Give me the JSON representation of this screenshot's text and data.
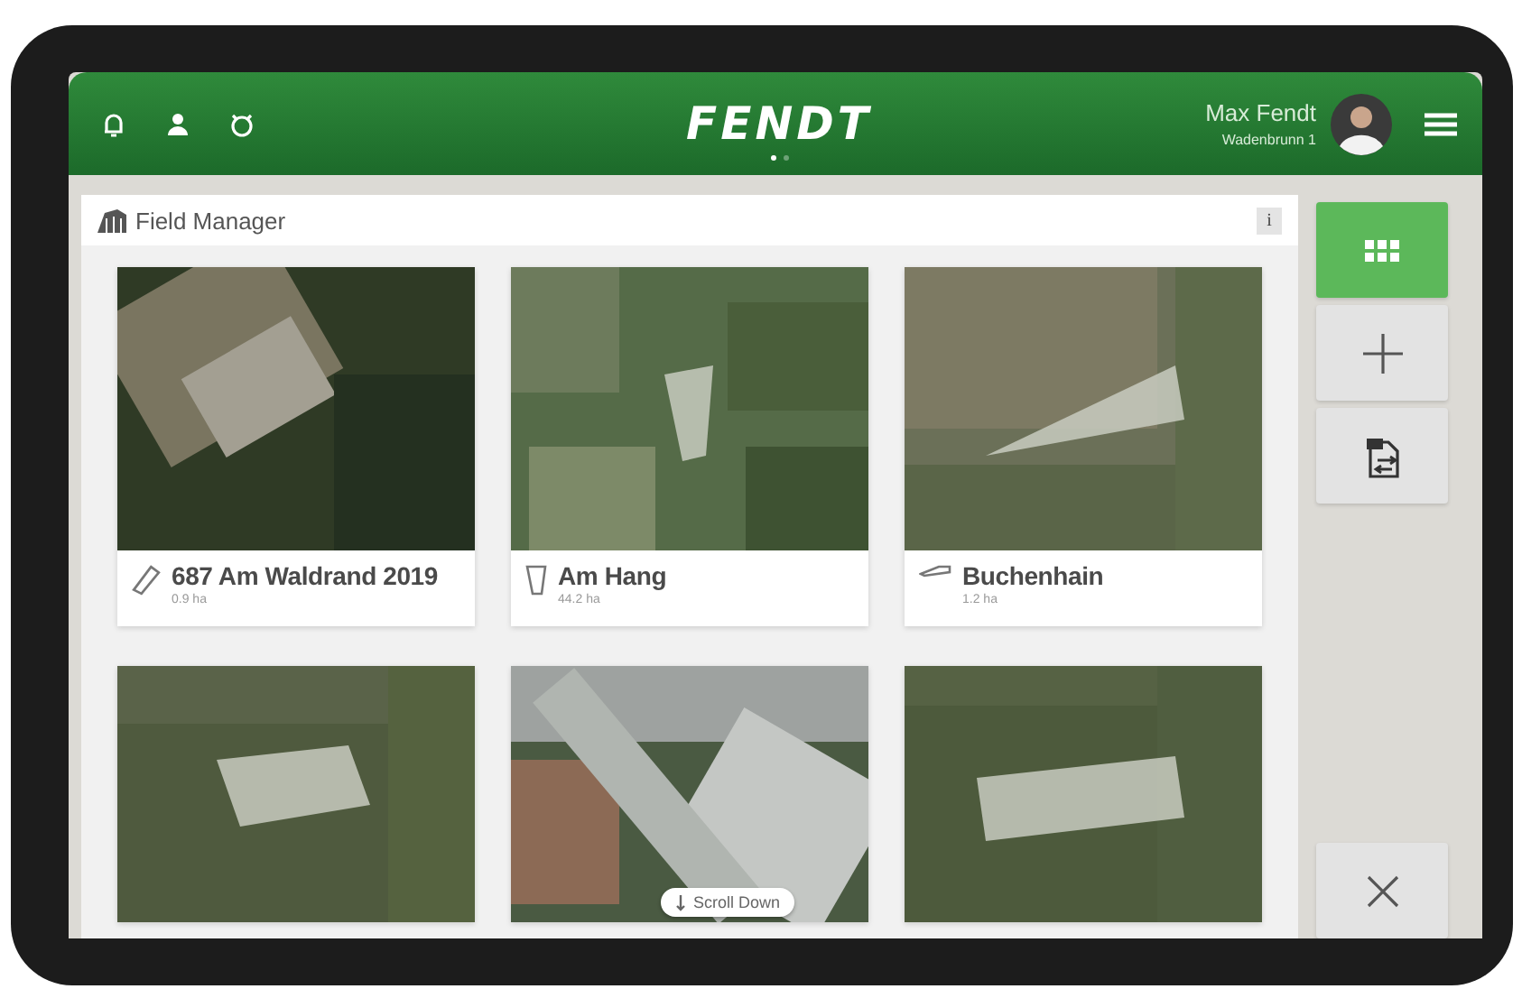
{
  "header": {
    "logo": "FENDT",
    "user_name": "Max Fendt",
    "user_location": "Wadenbrunn 1",
    "pager": [
      {
        "selected": true
      },
      {
        "selected": false
      }
    ]
  },
  "panel": {
    "title": "Field Manager",
    "info": "i"
  },
  "fields": [
    {
      "kind": "card",
      "name": "687 Am Waldrand 2019",
      "area": "0.9 ha"
    },
    {
      "kind": "card",
      "name": "Am Hang",
      "area": "44.2 ha"
    },
    {
      "kind": "card",
      "name": "Buchenhain",
      "area": "1.2 ha"
    },
    {
      "kind": "picture"
    },
    {
      "kind": "picture"
    },
    {
      "kind": "picture"
    }
  ],
  "scroll_hint": "Scroll Down",
  "sidebar": [
    {
      "kind": "grid",
      "selected": true
    },
    {
      "kind": "add",
      "selected": false
    },
    {
      "kind": "import",
      "selected": false
    },
    {
      "kind": "close",
      "selected": false
    }
  ]
}
